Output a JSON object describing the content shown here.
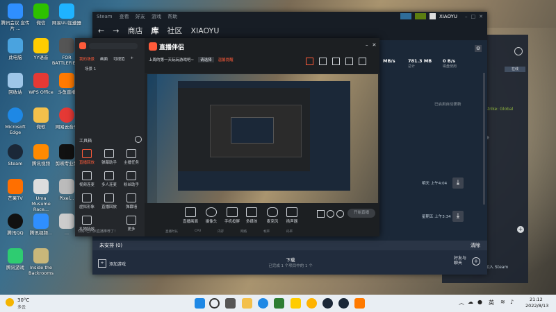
{
  "desktop": {
    "icons": [
      {
        "label": "腾讯会议\n宣传片\n...",
        "color": "#2f8fff"
      },
      {
        "label": "微信",
        "color": "#2dc100"
      },
      {
        "label": "网易UU加速器",
        "color": "#1fb3ff"
      },
      {
        "label": "此电脑",
        "color": "#4aa3df"
      },
      {
        "label": "YY语音",
        "color": "#ffcc00"
      },
      {
        "label": "FOR BATTLEFIELD",
        "color": "#555555"
      },
      {
        "label": "回收站",
        "color": "#9ec6e8"
      },
      {
        "label": "WPS Office",
        "color": "#e53935"
      },
      {
        "label": "斗鱼直播",
        "color": "#ff7a00"
      },
      {
        "label": "Microsoft Edge",
        "color": "#1e88e5"
      },
      {
        "label": "微软",
        "color": "#f3c04b"
      },
      {
        "label": "网易云音乐",
        "color": "#e53935"
      },
      {
        "label": "Steam",
        "color": "#1b2838"
      },
      {
        "label": "腾讯视频",
        "color": "#ff8a00"
      },
      {
        "label": "剪映专业版",
        "color": "#111111"
      },
      {
        "label": "芒果TV",
        "color": "#ff6f00"
      },
      {
        "label": "Uma Musume Race...",
        "color": "#dddddd"
      },
      {
        "label": "Pixel...",
        "color": "#bbbbbb"
      },
      {
        "label": "腾讯QQ",
        "color": "#111111"
      },
      {
        "label": "腾讯视频...",
        "color": "#2f8fff"
      },
      {
        "label": "...",
        "color": "#cccccc"
      },
      {
        "label": "腾讯游戏",
        "color": "#2ecc71"
      },
      {
        "label": "Inside the Backrooms",
        "color": "#c9b77a"
      }
    ]
  },
  "steam": {
    "title": "Steam",
    "menu": [
      "查看",
      "好友",
      "游戏",
      "帮助"
    ],
    "nav": {
      "back": "←",
      "forward": "→",
      "store": "商店",
      "library": "库",
      "community": "社区",
      "user": "XIAOYU"
    },
    "account": "XIAOYU",
    "stats": [
      {
        "value": "MB/s",
        "label": ""
      },
      {
        "value": "781.3 MB",
        "label": "总计"
      },
      {
        "value": "0 B/s",
        "label": "磁盘使用"
      }
    ],
    "auto_update_text": "已启用自动更新",
    "downloads": [
      {
        "time": "明天 上午4:04"
      },
      {
        "time": "星期五 上午3:34"
      }
    ],
    "uninstalled": "未安排 (0)",
    "clear": "清除",
    "add_game": "添加游戏",
    "download_label": "下载",
    "download_sub": "已完成 1 个项目中的 1 个",
    "friends_chat": "好友与\n聊天"
  },
  "friends": {
    "online_text": "在线",
    "game_snippet": "Strike: Global",
    "card": "卡",
    "hint": "加入 Steam"
  },
  "live": {
    "logo": "直播伴侣",
    "tabs": [
      "我的场景",
      "画面",
      "可视范"
    ],
    "scene": "场景 1",
    "topics": [
      "上周的第一天玩玩游戏吧~",
      "请选择",
      "温馨提醒"
    ],
    "toolbox_title": "工具箱",
    "side_tools": [
      {
        "label": "直播回放",
        "red": true
      },
      {
        "label": "弹幕助手",
        "red": false
      },
      {
        "label": "主播任务",
        "red": false
      },
      {
        "label": "视频连麦",
        "red": false
      },
      {
        "label": "多人连麦",
        "red": false
      },
      {
        "label": "粉丝助手",
        "red": false
      },
      {
        "label": "虚拟形象",
        "red": false
      },
      {
        "label": "直播回放",
        "red": false
      },
      {
        "label": "弹幕墙",
        "red": false
      },
      {
        "label": "礼物特效",
        "red": false
      },
      {
        "label": "更多",
        "red": false
      }
    ],
    "notice": "你好!已开启直播推荐了！",
    "bottom_tools": [
      "直播画面",
      "摄像头",
      "手机投屏",
      "多媒体",
      "麦克风",
      "扬声器"
    ],
    "status_items": [
      "直播时长",
      "CPU",
      "内存",
      "网络",
      "帧率",
      "码率"
    ],
    "start_button": "开始直播"
  },
  "taskbar": {
    "weather": "30°C",
    "weather_sub": "多云",
    "time": "21:12",
    "date": "2022/8/13",
    "lang": "英"
  }
}
